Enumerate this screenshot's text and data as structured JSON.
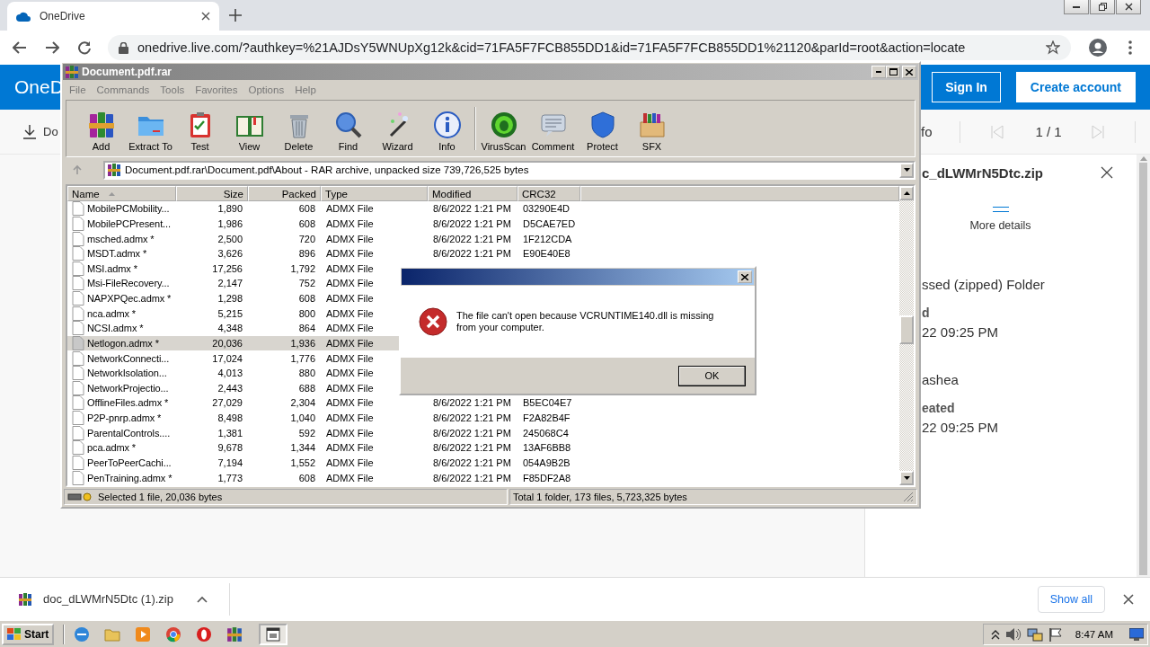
{
  "browser": {
    "tabs": [
      {
        "title": "OneDrive",
        "selected": true
      }
    ],
    "url": "onedrive.live.com/?authkey=%21AJDsY5WNUpXg12k&cid=71FA5F7FCB855DD1&id=71FA5F7FCB855DD1%21120&parId=root&action=locate"
  },
  "onedrive": {
    "brand": "OneD",
    "sign_in": "Sign In",
    "create_account": "Create account",
    "toolbar_left": "Do",
    "toolbar_right": "fo",
    "page_counter": "1 / 1",
    "info_panel": {
      "title": "c_dLWMrN5Dtc.zip",
      "more_details": "More details",
      "groups": [
        {
          "value": "ssed (zipped) Folder"
        },
        {
          "label": "d",
          "value": "22 09:25 PM"
        },
        {
          "value": "ashea"
        },
        {
          "label": "eated",
          "value": "22 09:25 PM"
        }
      ]
    }
  },
  "winrar": {
    "title": "Document.pdf.rar",
    "menu": [
      "File",
      "Commands",
      "Tools",
      "Favorites",
      "Options",
      "Help"
    ],
    "toolbar_groups": [
      [
        "Add",
        "Extract To",
        "Test",
        "View",
        "Delete",
        "Find",
        "Wizard",
        "Info"
      ],
      [
        "VirusScan",
        "Comment",
        "Protect",
        "SFX"
      ]
    ],
    "path": "Document.pdf.rar\\Document.pdf\\About - RAR archive, unpacked size 739,726,525 bytes",
    "columns": [
      {
        "label": "Name",
        "sorted": true
      },
      {
        "label": "Size",
        "sorted": false
      },
      {
        "label": "Packed",
        "sorted": false
      },
      {
        "label": "Type",
        "sorted": false
      },
      {
        "label": "Modified",
        "sorted": false
      },
      {
        "label": "CRC32",
        "sorted": false
      }
    ],
    "rows": [
      {
        "name": "MobilePCMobility...",
        "size": "1,890",
        "packed": "608",
        "type": "ADMX File",
        "modified": "8/6/2022 1:21 PM",
        "crc32": "03290E4D",
        "selected": false
      },
      {
        "name": "MobilePCPresent...",
        "size": "1,986",
        "packed": "608",
        "type": "ADMX File",
        "modified": "8/6/2022 1:21 PM",
        "crc32": "D5CAE7ED",
        "selected": false
      },
      {
        "name": "msched.admx *",
        "size": "2,500",
        "packed": "720",
        "type": "ADMX File",
        "modified": "8/6/2022 1:21 PM",
        "crc32": "1F212CDA",
        "selected": false
      },
      {
        "name": "MSDT.admx *",
        "size": "3,626",
        "packed": "896",
        "type": "ADMX File",
        "modified": "8/6/2022 1:21 PM",
        "crc32": "E90E40E8",
        "selected": false
      },
      {
        "name": "MSI.admx *",
        "size": "17,256",
        "packed": "1,792",
        "type": "ADMX File",
        "selected": false
      },
      {
        "name": "Msi-FileRecovery...",
        "size": "2,147",
        "packed": "752",
        "type": "ADMX File",
        "selected": false
      },
      {
        "name": "NAPXPQec.admx *",
        "size": "1,298",
        "packed": "608",
        "type": "ADMX File",
        "selected": false
      },
      {
        "name": "nca.admx *",
        "size": "5,215",
        "packed": "800",
        "type": "ADMX File",
        "selected": false
      },
      {
        "name": "NCSI.admx *",
        "size": "4,348",
        "packed": "864",
        "type": "ADMX File",
        "selected": false
      },
      {
        "name": "Netlogon.admx *",
        "size": "20,036",
        "packed": "1,936",
        "type": "ADMX File",
        "selected": true
      },
      {
        "name": "NetworkConnecti...",
        "size": "17,024",
        "packed": "1,776",
        "type": "ADMX File",
        "selected": false
      },
      {
        "name": "NetworkIsolation...",
        "size": "4,013",
        "packed": "880",
        "type": "ADMX File",
        "selected": false
      },
      {
        "name": "NetworkProjectio...",
        "size": "2,443",
        "packed": "688",
        "type": "ADMX File",
        "selected": false
      },
      {
        "name": "OfflineFiles.admx *",
        "size": "27,029",
        "packed": "2,304",
        "type": "ADMX File",
        "modified": "8/6/2022 1:21 PM",
        "crc32": "B5EC04E7",
        "selected": false
      },
      {
        "name": "P2P-pnrp.admx *",
        "size": "8,498",
        "packed": "1,040",
        "type": "ADMX File",
        "modified": "8/6/2022 1:21 PM",
        "crc32": "F2A82B4F",
        "selected": false
      },
      {
        "name": "ParentalControls....",
        "size": "1,381",
        "packed": "592",
        "type": "ADMX File",
        "modified": "8/6/2022 1:21 PM",
        "crc32": "245068C4",
        "selected": false
      },
      {
        "name": "pca.admx *",
        "size": "9,678",
        "packed": "1,344",
        "type": "ADMX File",
        "modified": "8/6/2022 1:21 PM",
        "crc32": "13AF6BB8",
        "selected": false
      },
      {
        "name": "PeerToPeerCachi...",
        "size": "7,194",
        "packed": "1,552",
        "type": "ADMX File",
        "modified": "8/6/2022 1:21 PM",
        "crc32": "054A9B2B",
        "selected": false
      },
      {
        "name": "PenTraining.admx *",
        "size": "1,773",
        "packed": "608",
        "type": "ADMX File",
        "modified": "8/6/2022 1:21 PM",
        "crc32": "F85DF2A8",
        "selected": false
      }
    ],
    "status_left": "Selected 1 file, 20,036 bytes",
    "status_right": "Total 1 folder, 173 files, 5,723,325 bytes"
  },
  "dialog": {
    "message": "The file can't open because VCRUNTIME140.dll is missing from your computer.",
    "ok": "OK"
  },
  "downloads": {
    "file": "doc_dLWMrN5Dtc (1).zip",
    "show_all": "Show all"
  },
  "taskbar": {
    "start": "Start",
    "clock": "8:47 AM"
  }
}
